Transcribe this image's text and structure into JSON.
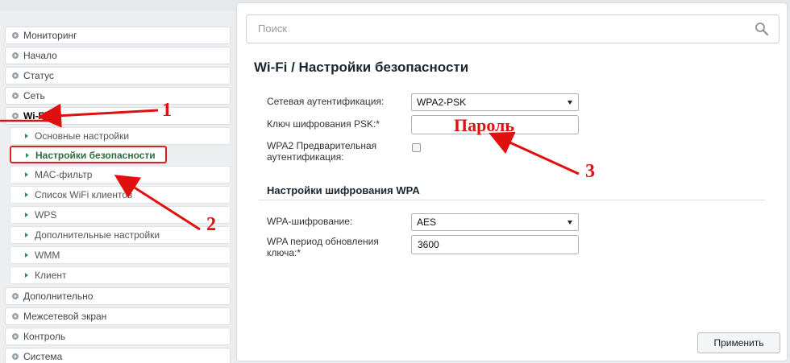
{
  "sidebar": {
    "items": [
      {
        "label": "Мониторинг"
      },
      {
        "label": "Начало"
      },
      {
        "label": "Статус"
      },
      {
        "label": "Сеть"
      },
      {
        "label": "Wi-Fi"
      }
    ],
    "wifi_sub": [
      {
        "label": "Основные настройки"
      },
      {
        "label": "Настройки безопасности"
      },
      {
        "label": "МАС-фильтр"
      },
      {
        "label": "Список WiFi клиентов"
      },
      {
        "label": "WPS"
      },
      {
        "label": "Дополнительные настройки"
      },
      {
        "label": "WMM"
      },
      {
        "label": "Клиент"
      }
    ],
    "bottom_items": [
      {
        "label": "Дополнительно"
      },
      {
        "label": "Межсетевой экран"
      },
      {
        "label": "Контроль"
      },
      {
        "label": "Система"
      }
    ]
  },
  "search": {
    "placeholder": "Поиск"
  },
  "page": {
    "title": "Wi-Fi /  Настройки безопасности",
    "auth_label": "Сетевая аутентификация:",
    "auth_value": "WPA2-PSK",
    "psk_label": "Ключ шифрования PSK:*",
    "psk_value": "",
    "preauth_label": "WPA2 Предварительная аутентификация:",
    "preauth_checked": false,
    "section_title": "Настройки шифрования WPA",
    "enc_label": "WPA-шифрование:",
    "enc_value": "AES",
    "period_label": "WPA период обновления ключа:*",
    "period_value": "3600",
    "apply_label": "Применить"
  },
  "annotations": {
    "n1": "1",
    "n2": "2",
    "n3": "3",
    "password_label": "Пароль"
  },
  "colors": {
    "annotation": "#e01010",
    "accent_green": "#2b6e3c"
  },
  "icons": [
    "search-icon",
    "chevron-right-icon",
    "caret-down-icon"
  ]
}
